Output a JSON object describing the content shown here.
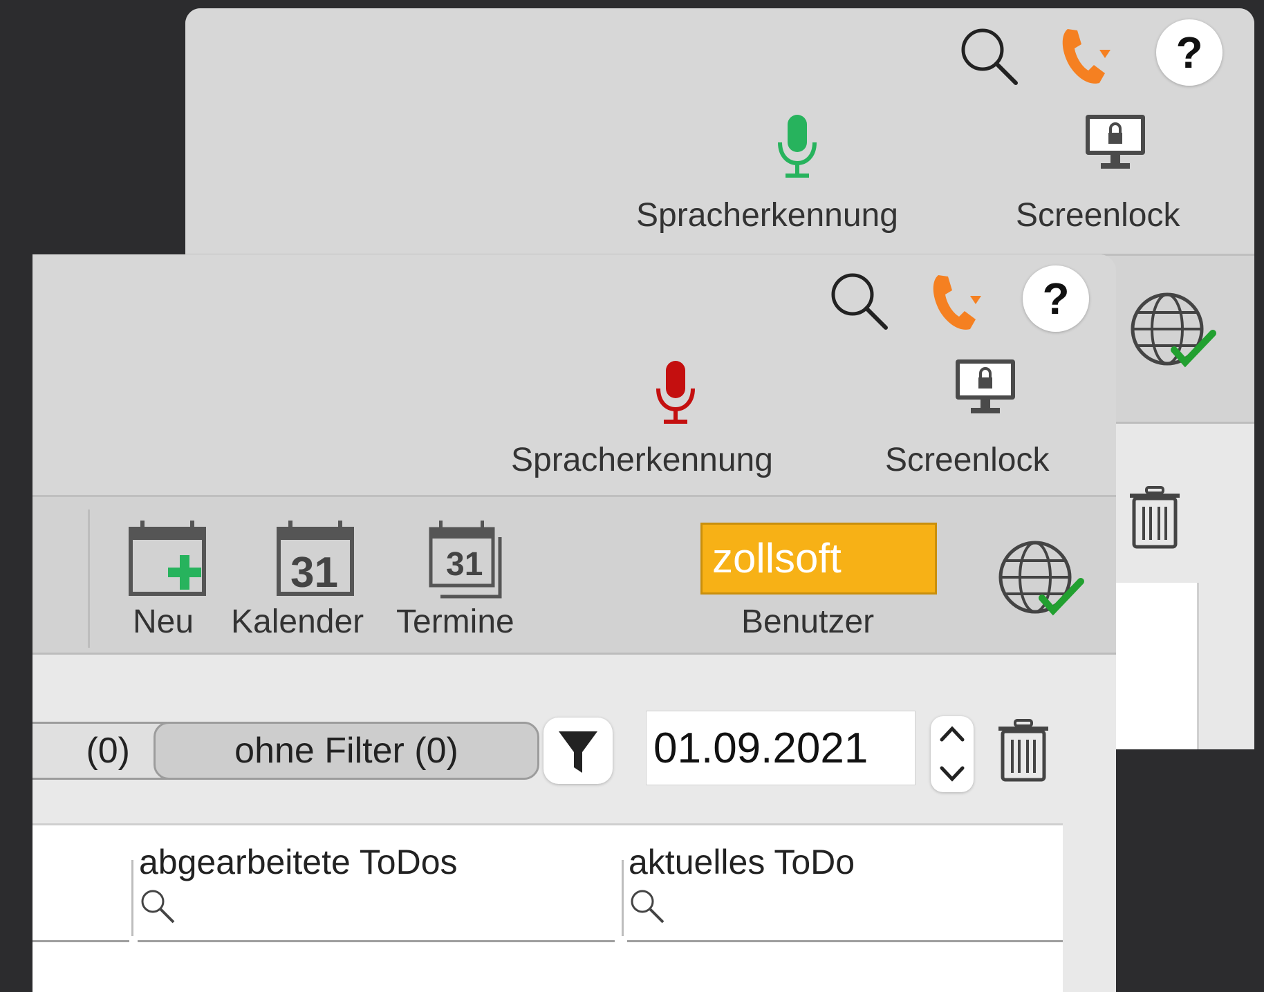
{
  "back_window": {
    "toolbar": {
      "speech_label": "Spracherkennung",
      "screenlock_label": "Screenlock",
      "help_label": "?"
    }
  },
  "front_window": {
    "toolbar": {
      "speech_label": "Spracherkennung",
      "screenlock_label": "Screenlock",
      "help_label": "?",
      "new_label": "Neu",
      "calendar_label": "Kalender",
      "calendar_day": "31",
      "appointments_label": "Termine",
      "appointments_day": "31",
      "user_value": "zollsoft",
      "user_label": "Benutzer"
    },
    "filters": {
      "partial_filter_label": "(0)",
      "no_filter_label": "ohne Filter (0)",
      "date_value": "01.09.2021"
    },
    "table": {
      "columns": [
        {
          "label": ""
        },
        {
          "label": "abgearbeitete ToDos"
        },
        {
          "label": "aktuelles ToDo"
        }
      ]
    }
  },
  "colors": {
    "mic_active": "#27b35d",
    "mic_inactive": "#c40f0f",
    "phone": "#f58021",
    "user_badge": "#f7b116",
    "check_green": "#22a030"
  }
}
